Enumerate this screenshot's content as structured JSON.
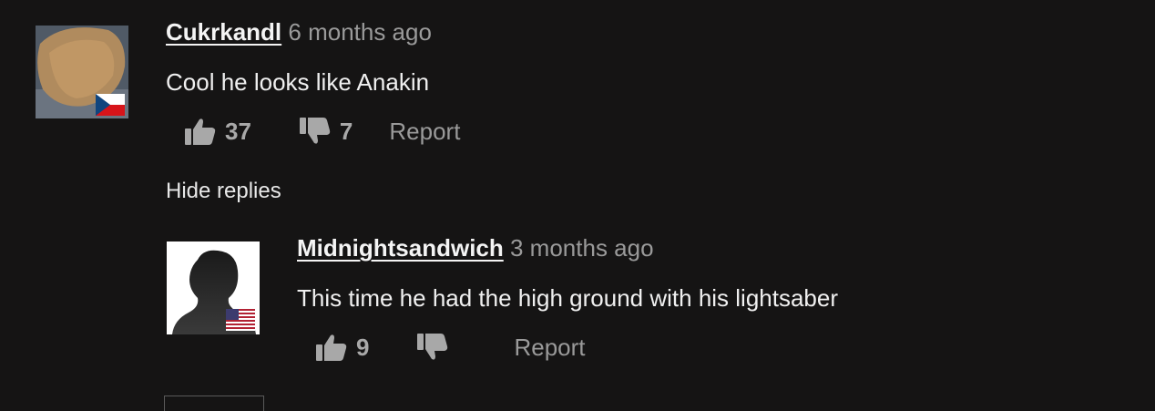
{
  "comments": [
    {
      "username": "Cukrkandl",
      "time": "6 months ago",
      "text": "Cool he looks like Anakin",
      "likes": "37",
      "dislikes": "7",
      "report_label": "Report",
      "flag": "czech-flag-icon"
    }
  ],
  "thread": {
    "hide_replies_label": "Hide replies"
  },
  "replies": [
    {
      "username": "Midnightsandwich",
      "time": "3 months ago",
      "text": "This time he had the high ground with his lightsaber",
      "likes": "9",
      "dislikes": "",
      "report_label": "Report",
      "flag": "us-flag-icon"
    }
  ],
  "colors": {
    "background": "#151414",
    "muted_text": "#9a9a9a",
    "icon": "#a8a8a8"
  }
}
